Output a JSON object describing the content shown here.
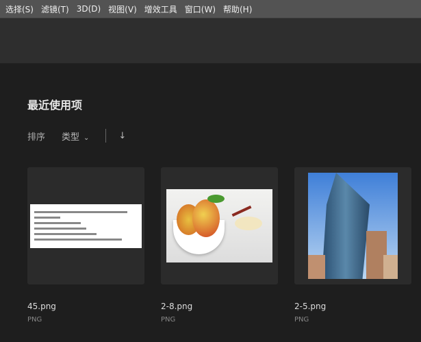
{
  "menu": [
    "选择(S)",
    "滤镜(T)",
    "3D(D)",
    "视图(V)",
    "增效工具",
    "窗口(W)",
    "帮助(H)"
  ],
  "recent": {
    "title": "最近使用项",
    "sort_label": "排序",
    "sort_value": "类型"
  },
  "files": [
    {
      "name": "45.png",
      "type": "PNG"
    },
    {
      "name": "2-8.png",
      "type": "PNG"
    },
    {
      "name": "2-5.png",
      "type": "PNG"
    }
  ]
}
